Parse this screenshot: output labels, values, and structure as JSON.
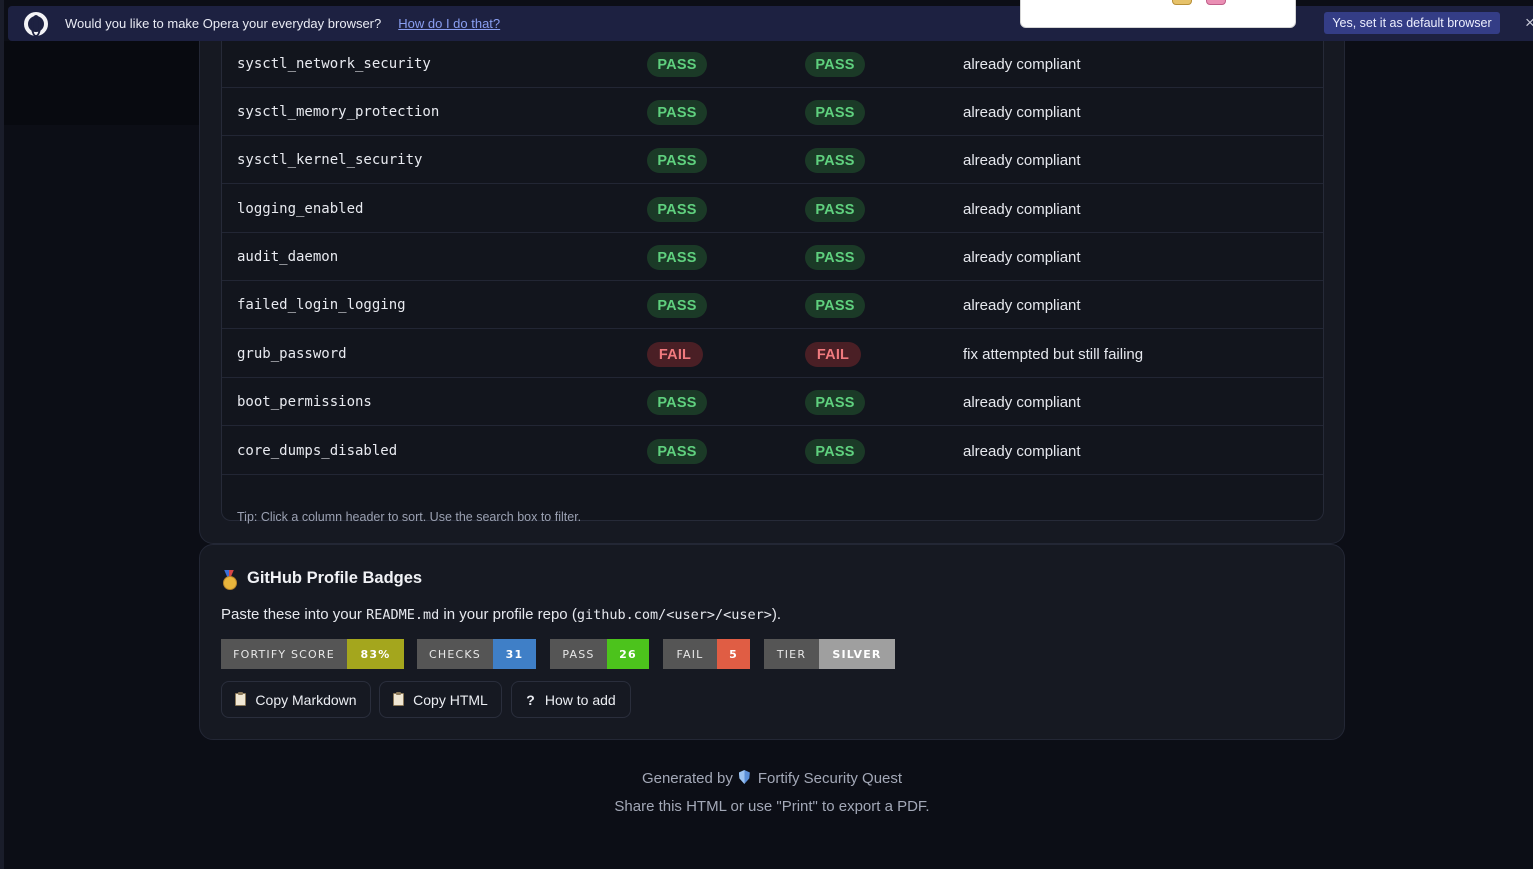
{
  "opera_bar": {
    "message": "Would you like to make Opera your everyday browser?",
    "link": "How do I do that?",
    "default_button": "Yes, set it as default browser",
    "close": "×"
  },
  "results": {
    "rows": [
      {
        "name": "sysctl_network_security",
        "before": "PASS",
        "after": "PASS",
        "note": "already compliant"
      },
      {
        "name": "sysctl_memory_protection",
        "before": "PASS",
        "after": "PASS",
        "note": "already compliant"
      },
      {
        "name": "sysctl_kernel_security",
        "before": "PASS",
        "after": "PASS",
        "note": "already compliant"
      },
      {
        "name": "logging_enabled",
        "before": "PASS",
        "after": "PASS",
        "note": "already compliant"
      },
      {
        "name": "audit_daemon",
        "before": "PASS",
        "after": "PASS",
        "note": "already compliant"
      },
      {
        "name": "failed_login_logging",
        "before": "PASS",
        "after": "PASS",
        "note": "already compliant"
      },
      {
        "name": "grub_password",
        "before": "FAIL",
        "after": "FAIL",
        "note": "fix attempted but still failing"
      },
      {
        "name": "boot_permissions",
        "before": "PASS",
        "after": "PASS",
        "note": "already compliant"
      },
      {
        "name": "core_dumps_disabled",
        "before": "PASS",
        "after": "PASS",
        "note": "already compliant"
      }
    ],
    "tip": "Tip: Click a column header to sort. Use the search box to filter."
  },
  "badges": {
    "title": "GitHub Profile Badges",
    "desc_prefix": "Paste these into your ",
    "desc_file": "README.md",
    "desc_middle": " in your profile repo (",
    "desc_repo": "github.com/<user>/<user>",
    "desc_suffix": ").",
    "items": [
      {
        "label": "FORTIFY SCORE",
        "value": "83%",
        "color": "#a4a61d"
      },
      {
        "label": "CHECKS",
        "value": "31",
        "color": "#3f7fc7"
      },
      {
        "label": "PASS",
        "value": "26",
        "color": "#4cc31c"
      },
      {
        "label": "FAIL",
        "value": "5",
        "color": "#e05d44"
      },
      {
        "label": "TIER",
        "value": "SILVER",
        "color": "#9f9f9f"
      }
    ],
    "buttons": {
      "copy_markdown": "Copy Markdown",
      "copy_html": "Copy HTML",
      "how_to_add": "How to add"
    }
  },
  "footer": {
    "generated_by": "Generated by",
    "product": "Fortify Security Quest",
    "share": "Share this HTML or use \"Print\" to export a PDF."
  }
}
